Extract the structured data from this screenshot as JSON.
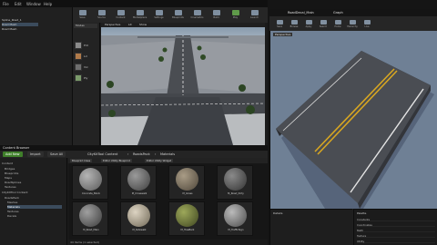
{
  "left_window": {
    "menu": [
      "File",
      "Edit",
      "Window",
      "Help"
    ],
    "toolbar": [
      "Save",
      "Source",
      "Content",
      "Marketplace",
      "Settings",
      "Blueprints",
      "Cinematics",
      "Build",
      "Play",
      "Launch"
    ]
  },
  "outliner": {
    "items": [
      "Spline_Road_1",
      "Road Mesh",
      "Road Mesh"
    ],
    "selected_index": 1
  },
  "modes": {
    "tab": "Modes",
    "items": [
      {
        "label": "Pnt",
        "color": "#8a8a8a"
      },
      {
        "label": "Lcl",
        "color": "#b07a4a"
      },
      {
        "label": "Vol",
        "color": "#6e6e6e"
      },
      {
        "label": "Ply",
        "color": "#7a9a6a"
      }
    ]
  },
  "viewport": {
    "tabs": [
      "Perspective",
      "Lit",
      "Show"
    ]
  },
  "content_browser": {
    "title": "Content Browser",
    "buttons": {
      "add_new": "Add New",
      "import": "Import",
      "save_all": "Save All"
    },
    "breadcrumb": [
      "CityKitTool Content",
      "RoadsPack",
      "Materials"
    ],
    "filters": [
      "Blueprint Class",
      "Editor Utility Blueprint",
      "Editor Utility Widget"
    ],
    "tree": [
      {
        "label": "Content",
        "selected": false
      },
      {
        "label": "Bridges",
        "selected": false
      },
      {
        "label": "Blueprints",
        "selected": false
      },
      {
        "label": "Maps",
        "selected": false
      },
      {
        "label": "RoadSplines",
        "selected": false
      },
      {
        "label": "Textures",
        "selected": false
      },
      {
        "label": "CityKitTool Content",
        "selected": false
      },
      {
        "label": "RoadsPack",
        "selected": false
      },
      {
        "label": "Meshes",
        "selected": false
      },
      {
        "label": "Materials",
        "selected": true
      },
      {
        "label": "Textures",
        "selected": false
      },
      {
        "label": "Decals",
        "selected": false
      }
    ],
    "assets": [
      {
        "name": "Concrete_Block",
        "color": "#8a8a8a"
      },
      {
        "name": "M_Crosswalk",
        "color": "#6d6d6d"
      },
      {
        "name": "M_Grass",
        "color": "#7a6f5e"
      },
      {
        "name": "M_Road_Dirty",
        "color": "#5c5c5c"
      },
      {
        "name": "M_Road_Main",
        "color": "#7b7b7b"
      },
      {
        "name": "M_Sidewalk",
        "color": "#a39b8b"
      },
      {
        "name": "M_TreeBark",
        "color": "#6f7a3a"
      },
      {
        "name": "M_TrafficSign",
        "color": "#8c8c8c"
      }
    ],
    "status": "44 items (1 selected)"
  },
  "right_window": {
    "tabs": [
      "RoadDecal_Main",
      "Graph"
    ],
    "toolbar": [
      "Save",
      "Browse",
      "Apply",
      "Search",
      "Home",
      "Hierarchy",
      "Live"
    ],
    "preview_label": "Perspective",
    "details_label": "Details",
    "palette_label": "Palette",
    "palette_items": [
      "Constants",
      "Coordinates",
      "Math",
      "Texture",
      "Utility"
    ]
  },
  "colors": {
    "accent": "#3b4b5c",
    "add_new": "#3f7f2a",
    "road": "#3b3e44",
    "line_yellow": "#d7a622"
  }
}
